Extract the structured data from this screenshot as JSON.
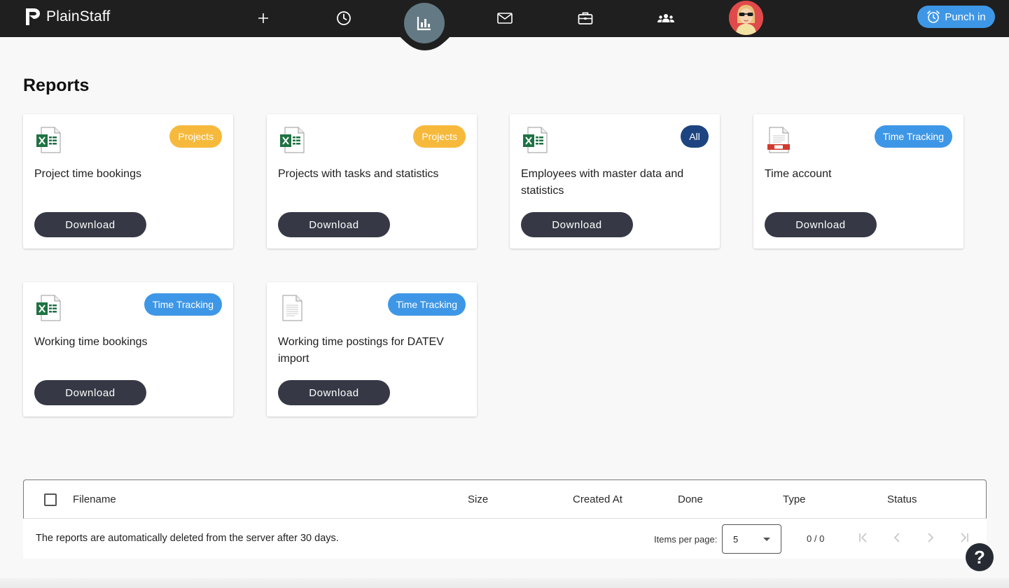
{
  "app": {
    "name": "PlainStaff",
    "punch_in_label": "Punch in"
  },
  "nav": [
    {
      "name": "add-icon"
    },
    {
      "name": "clock-icon"
    },
    {
      "name": "reports-chart-icon",
      "active": true
    },
    {
      "name": "mail-icon"
    },
    {
      "name": "briefcase-icon"
    },
    {
      "name": "team-icon"
    }
  ],
  "page": {
    "title": "Reports"
  },
  "reports": [
    {
      "title": "Project time bookings",
      "tag": "Projects",
      "file_type": "excel",
      "button": "Download"
    },
    {
      "title": "Projects with tasks and statistics",
      "tag": "Projects",
      "file_type": "excel",
      "button": "Download"
    },
    {
      "title": "Employees with master data and statistics",
      "tag": "All",
      "file_type": "excel",
      "button": "Download"
    },
    {
      "title": "Time account",
      "tag": "Time Tracking",
      "file_type": "pdf",
      "button": "Download"
    },
    {
      "title": "Working time bookings",
      "tag": "Time Tracking",
      "file_type": "excel",
      "button": "Download"
    },
    {
      "title": "Working time postings for DATEV import",
      "tag": "Time Tracking",
      "file_type": "text",
      "button": "Download"
    }
  ],
  "table": {
    "columns": [
      "Filename",
      "Size",
      "Created At",
      "Done",
      "Type",
      "Status"
    ],
    "rows": [],
    "note": "The reports are automatically deleted from the server after 30 days.",
    "items_per_page_label": "Items per page:",
    "items_per_page": "5",
    "range": "0 / 0"
  },
  "help_label": "?",
  "colors": {
    "topbar": "#1f1f1f",
    "active_nav": "#637984",
    "punch_in": "#3e97e6",
    "badge_projects": "#f7b93c",
    "badge_all": "#1d4480",
    "badge_time_tracking": "#3e97e6",
    "download_button": "#363945"
  }
}
